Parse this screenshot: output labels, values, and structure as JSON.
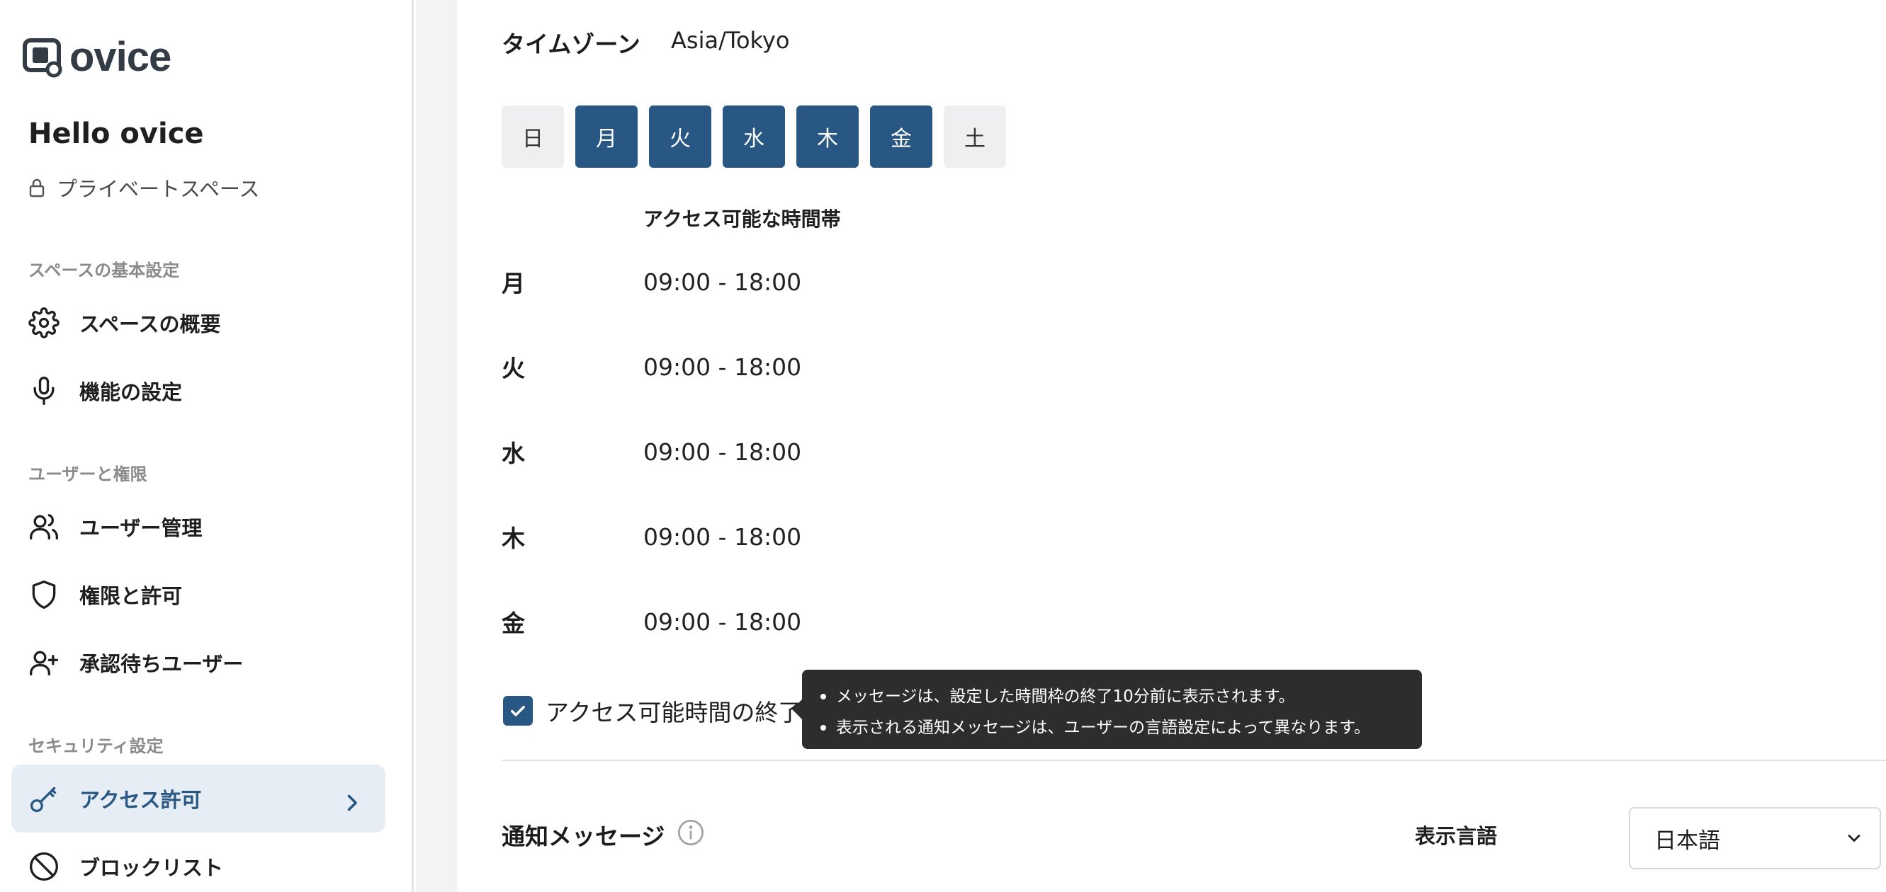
{
  "brand": {
    "name": "ovice"
  },
  "space": {
    "name": "Hello ovice",
    "type": "プライベートスペース"
  },
  "sidebar": {
    "sections": [
      {
        "label": "スペースの基本設定"
      },
      {
        "label": "ユーザーと権限"
      },
      {
        "label": "セキュリティ設定"
      }
    ],
    "items": [
      {
        "label": "スペースの概要",
        "icon": "gear-icon"
      },
      {
        "label": "機能の設定",
        "icon": "microphone-icon"
      },
      {
        "label": "ユーザー管理",
        "icon": "users-icon"
      },
      {
        "label": "権限と許可",
        "icon": "shield-icon"
      },
      {
        "label": "承認待ちユーザー",
        "icon": "user-plus-icon"
      },
      {
        "label": "アクセス許可",
        "icon": "key-icon",
        "active": true
      },
      {
        "label": "ブロックリスト",
        "icon": "block-icon"
      }
    ]
  },
  "main": {
    "timezone": {
      "label": "タイムゾーン",
      "value": "Asia/Tokyo"
    },
    "days": [
      {
        "label": "日",
        "selected": false
      },
      {
        "label": "月",
        "selected": true
      },
      {
        "label": "火",
        "selected": true
      },
      {
        "label": "水",
        "selected": true
      },
      {
        "label": "木",
        "selected": true
      },
      {
        "label": "金",
        "selected": true
      },
      {
        "label": "土",
        "selected": false
      }
    ],
    "hours_header": "アクセス可能な時間帯",
    "hours": [
      {
        "day": "月",
        "range": "09:00 - 18:00"
      },
      {
        "day": "火",
        "range": "09:00 - 18:00"
      },
      {
        "day": "水",
        "range": "09:00 - 18:00"
      },
      {
        "day": "木",
        "range": "09:00 - 18:00"
      },
      {
        "day": "金",
        "range": "09:00 - 18:00"
      }
    ],
    "force_logout": {
      "label": "アクセス可能時間の終了時に、管理者以外のユーザーを強制的に退出",
      "checked": true
    },
    "tooltip": [
      "メッセージは、設定した時間枠の終了10分前に表示されます。",
      "表示される通知メッセージは、ユーザーの言語設定によって異なります。"
    ],
    "notification": {
      "label": "通知メッセージ",
      "lang_label": "表示言語",
      "lang_value": "日本語"
    }
  },
  "colors": {
    "accent": "#285784",
    "active_bg": "#e7edf4",
    "tooltip_bg": "#2d2d2d"
  }
}
